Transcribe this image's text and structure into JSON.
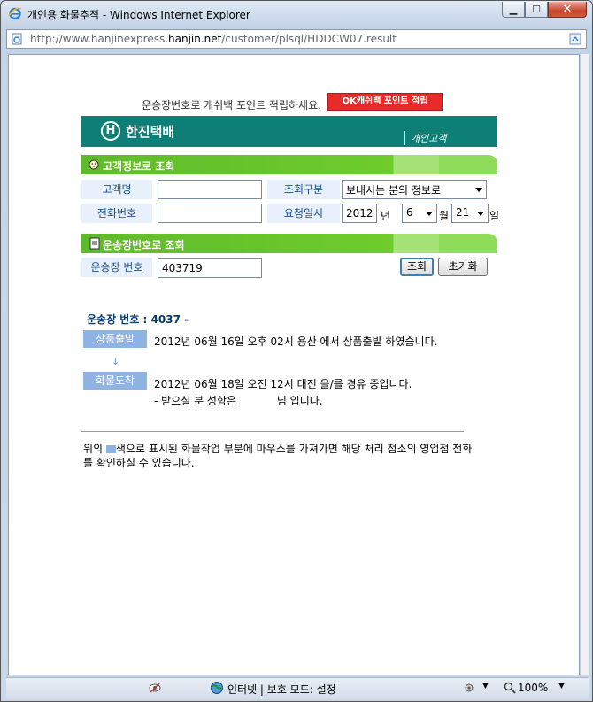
{
  "window": {
    "title": "개인용 화물추적 - Windows Internet Explorer"
  },
  "address": {
    "prefix": "http://www.hanjinexpress.",
    "domain": "hanjin.net",
    "suffix": "/customer/plsql/HDDCW07.result"
  },
  "promo": {
    "text": "운송장번호로 캐쉬백 포인트 적립하세요.",
    "button": "OK캐쉬백 포인트 적립"
  },
  "logo": {
    "brand": "한진택배",
    "sub": "개인고객"
  },
  "section1": {
    "title": "고객정보로 조회",
    "customer_label": "고객명",
    "customer_value": "",
    "phone_label": "전화번호",
    "phone_value": "",
    "type_label": "조회구분",
    "type_value": "보내시는 분의 정보로",
    "date_label": "요청일시",
    "year": "2012",
    "year_unit": "년",
    "month": "6",
    "month_unit": "월",
    "day": "21",
    "day_unit": "일"
  },
  "section2": {
    "title": "운송장번호로 조회",
    "waybill_label": "운송장 번호",
    "waybill_value": "403719",
    "search_button": "조회",
    "reset_button": "초기화"
  },
  "result": {
    "header": "운송장 번호 : 4037 -",
    "events": [
      {
        "tag": "상품출발",
        "text": "2012년 06월 16일 오후 02시 용산 에서 상품출발 하였습니다."
      },
      {
        "tag": "화물도착",
        "text": "2012년 06월 18일 오전 12시 대전 을/를 경유 중입니다.",
        "extra": "- 받으실 분 성함은            님 입니다."
      }
    ],
    "arrow": "↓"
  },
  "note": {
    "part1": "위의 ",
    "part2": "색으로 표시된 화물작업 부분에 마우스를 가져가면 해당 처리 점소의 영업점 전화를 확인하실 수 있습니다."
  },
  "statusbar": {
    "zone": "인터넷 | 보호 모드: 설정",
    "zoom": "100%"
  },
  "colors": {
    "brand": "#0e7f77",
    "section": "#6fcc2c",
    "tag": "#8fb3e2",
    "ok": "#e52b2b"
  }
}
